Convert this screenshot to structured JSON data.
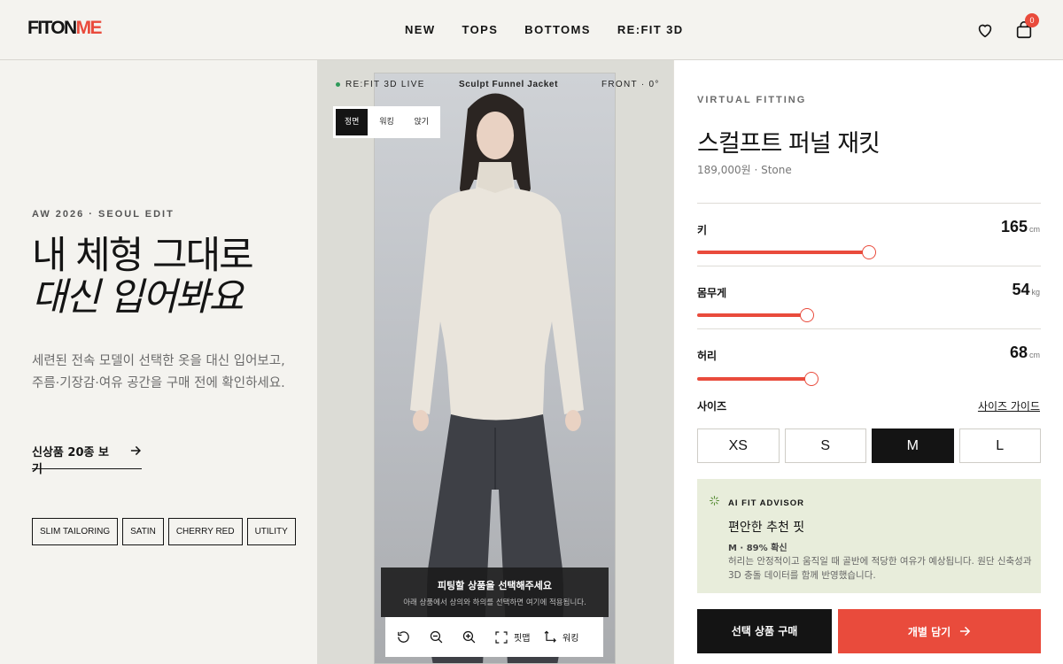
{
  "brand": {
    "logo_part1": "FITON",
    "logo_part2": "ME"
  },
  "nav": [
    "NEW",
    "TOPS",
    "BOTTOMS",
    "RE:FIT 3D"
  ],
  "header": {
    "cart_count": "0"
  },
  "hero": {
    "eyebrow": "AW 2026 · SEOUL EDIT",
    "title_line1": "내 체형 그대로",
    "title_line2": "대신 입어봐요",
    "description": "세련된 전속 모델이 선택한 옷을 대신 입어보고, 주름·기장감·여유 공간을 구매 전에 확인하세요.",
    "cta": "신상품 20종 보기",
    "tags": [
      "SLIM TAILORING",
      "SATIN",
      "CHERRY RED",
      "UTILITY"
    ]
  },
  "stage": {
    "live_label": "RE:FIT 3D LIVE",
    "product_title": "Sculpt Funnel Jacket",
    "view_angle": "FRONT · 0°",
    "view_tabs": [
      "정면",
      "워킹",
      "앉기"
    ],
    "active_view": 0,
    "select_title": "피팅할 상품을 선택해주세요",
    "select_sub": "아래 상품에서 상의와 하의를 선택하면 여기에 적용됩니다.",
    "toolbar": {
      "fitmap": "핏맵",
      "walking": "워킹"
    }
  },
  "panel": {
    "eyebrow": "VIRTUAL FITTING",
    "product_name": "스컬프트 퍼널 재킷",
    "product_meta": "189,000원 · Stone",
    "sliders": [
      {
        "label": "키",
        "value": "165",
        "unit": "cm",
        "fraction": 0.499
      },
      {
        "label": "몸무게",
        "value": "54",
        "unit": "kg",
        "fraction": 0.319
      },
      {
        "label": "허리",
        "value": "68",
        "unit": "cm",
        "fraction": 0.332
      }
    ],
    "size_label": "사이즈",
    "size_guide": "사이즈 가이드",
    "sizes": [
      "XS",
      "S",
      "M",
      "L"
    ],
    "selected_size": "M",
    "advisor": {
      "label": "AI FIT ADVISOR",
      "title": "편안한 추천 핏",
      "confidence": "M · 89% 확신",
      "body": "허리는 안정적이고 움직일 때 골반에 적당한 여유가 예상됩니다. 원단 신축성과 3D 충돌 데이터를 함께 반영했습니다."
    },
    "buy_label": "선택 상품 구매",
    "cart_label": "개별 담기"
  },
  "colors": {
    "accent": "#e94b3c",
    "dark": "#141414",
    "advisor_bg": "#e8eddb",
    "live": "#2f9a5a"
  }
}
